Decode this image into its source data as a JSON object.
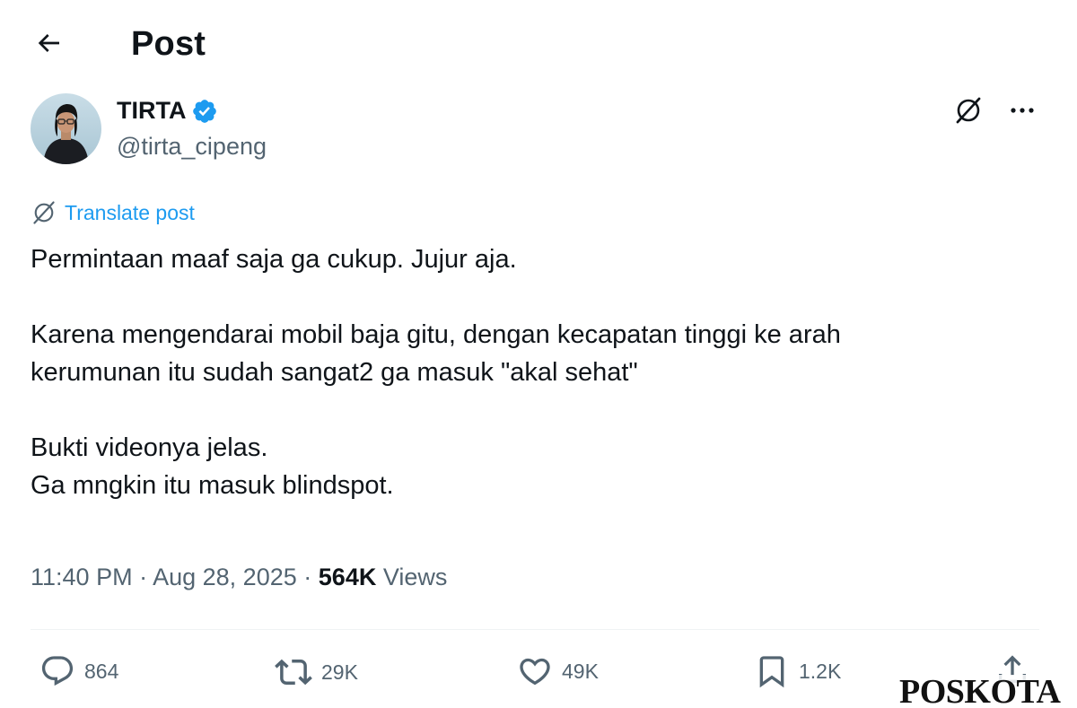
{
  "header": {
    "title": "Post",
    "back_icon": "arrow-left-icon"
  },
  "author": {
    "name": "TIRTA",
    "handle": "@tirta_cipeng",
    "verified": true,
    "badge_color": "#1d9bf0"
  },
  "top_actions": {
    "grok_icon": "grok-icon",
    "more_icon": "more-dots-icon"
  },
  "translate": {
    "label": "Translate post",
    "color": "#1d9bf0"
  },
  "post": {
    "paragraphs": [
      [
        "Permintaan maaf saja ga cukup. Jujur aja."
      ],
      [
        "Karena mengendarai mobil baja gitu, dengan kecapatan tinggi ke arah",
        "kerumunan itu sudah sangat2 ga masuk \"akal sehat\""
      ],
      [
        "Bukti videonya jelas.",
        "Ga mngkin itu masuk blindspot."
      ]
    ]
  },
  "meta": {
    "time": "11:40 PM",
    "separator": "·",
    "date": "Aug 28, 2025",
    "views_count": "564K",
    "views_label": "Views"
  },
  "actions": {
    "replies": "864",
    "reposts": "29K",
    "likes": "49K",
    "bookmarks": "1.2K"
  },
  "watermark": {
    "text": "POSKOTA"
  },
  "colors": {
    "text_primary": "#0f1419",
    "text_secondary": "#536471",
    "accent": "#1d9bf0",
    "divider": "#eff3f4"
  }
}
